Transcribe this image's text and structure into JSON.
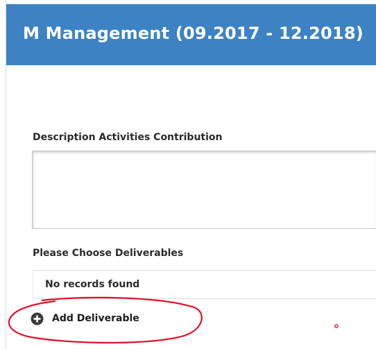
{
  "header": {
    "title": "M Management (09.2017 - 12.2018)"
  },
  "form": {
    "description_label": "Description Activities Contribution",
    "description_value": "",
    "deliverables_label": "Please Choose Deliverables",
    "records_empty_text": "No records found",
    "add_deliverable_label": "Add Deliverable"
  },
  "icons": {
    "add": "plus-circle-icon"
  },
  "colors": {
    "header_bg": "#3d82c3",
    "header_text": "#ffffff",
    "annotation_red": "#e0102a"
  }
}
